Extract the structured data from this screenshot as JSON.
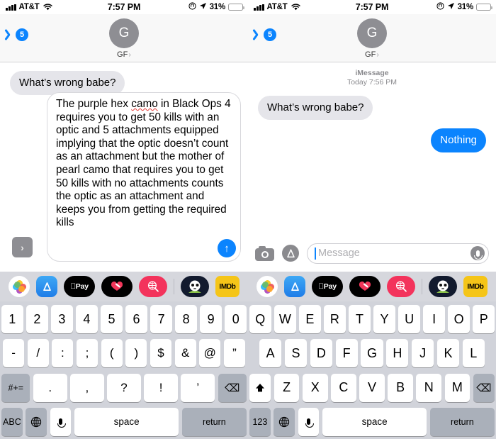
{
  "status_bar": {
    "carrier": "AT&T",
    "time": "7:57 PM",
    "battery_percent": "31%",
    "wifi_icon": "wifi-icon",
    "signal_icon": "signal-bars-icon",
    "location_icon": "location-arrow-icon",
    "lock_icon": "rotation-lock-icon",
    "battery_icon": "battery-low-power-icon",
    "battery_level": 31
  },
  "nav": {
    "back_badge": "5",
    "back_icon": "chevron-left-icon",
    "avatar_initial": "G",
    "contact_name": "GF",
    "contact_chevron": "›"
  },
  "left_panel": {
    "messages": [
      {
        "side": "incoming",
        "text": "What’s wrong babe?"
      }
    ],
    "composing": {
      "text_before": "The purple hex ",
      "misspelled_word": "camo",
      "text_after": " in Black Ops 4 requires you to get 50 kills with an optic and 5 attachments equipped implying that the optic doesn’t count as an attachment but the mother of pearl camo that requires you to get 50 kills with no attachments counts the optic as an attachment and keeps you from getting the required kills",
      "expand_label": "›",
      "send_label": "↑"
    }
  },
  "right_panel": {
    "timestamp_service": "iMessage",
    "timestamp_when": "Today 7:56 PM",
    "messages": [
      {
        "side": "incoming",
        "text": "What’s wrong babe?"
      },
      {
        "side": "outgoing",
        "text": "Nothing"
      }
    ],
    "input_bar": {
      "camera_icon": "camera-icon",
      "apps_icon": "app-store-icon",
      "placeholder": "Message",
      "mic_icon": "microphone-icon"
    }
  },
  "app_drawer": {
    "items": [
      {
        "name": "photos-app-icon",
        "label": ""
      },
      {
        "name": "app-store-app-icon",
        "label": ""
      },
      {
        "name": "apple-pay-app-icon",
        "label": "Pay"
      },
      {
        "name": "music-app-icon",
        "label": ""
      },
      {
        "name": "search-app-icon",
        "label": ""
      },
      {
        "name": "character-app-icon",
        "label": ""
      },
      {
        "name": "imdb-app-icon",
        "label": "IMDb"
      }
    ]
  },
  "keyboards": {
    "left": {
      "layout": "numeric",
      "row1": [
        "1",
        "2",
        "3",
        "4",
        "5",
        "6",
        "7",
        "8",
        "9",
        "0"
      ],
      "row2": [
        "-",
        "/",
        ":",
        ";",
        "(",
        ")",
        "$",
        "&",
        "@",
        "”"
      ],
      "row3_symbol_key": "#+=",
      "row3": [
        ".",
        ",",
        "?",
        "!",
        "’"
      ],
      "row3_delete": "⌫",
      "bottom": {
        "mode_key": "ABC",
        "globe_key": "⊕",
        "mic_key": "mic",
        "space_key": "space",
        "return_key": "return"
      }
    },
    "right": {
      "layout": "qwerty",
      "row1": [
        "Q",
        "W",
        "E",
        "R",
        "T",
        "Y",
        "U",
        "I",
        "O",
        "P"
      ],
      "row2": [
        "A",
        "S",
        "D",
        "F",
        "G",
        "H",
        "J",
        "K",
        "L"
      ],
      "row3_shift": "⬆",
      "row3": [
        "Z",
        "X",
        "C",
        "V",
        "B",
        "N",
        "M"
      ],
      "row3_delete": "⌫",
      "bottom": {
        "mode_key": "123",
        "globe_key": "⊕",
        "mic_key": "mic",
        "space_key": "space",
        "return_key": "return"
      }
    }
  },
  "colors": {
    "imessage_blue": "#0b84fe",
    "incoming_gray": "#e5e5ea",
    "keyboard_bg": "#d1d3da",
    "drawer_bg": "#d6d7dd",
    "battery_yellow": "#fdd835"
  }
}
